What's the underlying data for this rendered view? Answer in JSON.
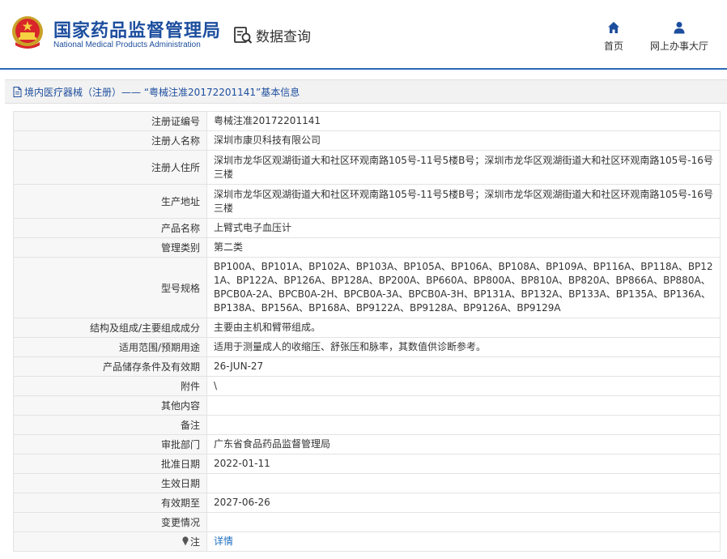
{
  "header": {
    "site_name_cn": "国家药品监督管理局",
    "site_name_en": "National Medical Products Administration",
    "query_label": "数据查询",
    "nav": [
      {
        "label": "首页",
        "icon": "home-icon"
      },
      {
        "label": "网上办事大厅",
        "icon": "user-icon"
      }
    ]
  },
  "breadcrumb": {
    "link": "境内医疗器械（注册）",
    "text": " —— “粤械注准20172201141”基本信息"
  },
  "rows": [
    {
      "key": "注册证编号",
      "value": "粤械注准20172201141"
    },
    {
      "key": "注册人名称",
      "value": "深圳市康贝科技有限公司"
    },
    {
      "key": "注册人住所",
      "value": "深圳市龙华区观湖街道大和社区环观南路105号-11号5楼B号；深圳市龙华区观湖街道大和社区环观南路105号-16号三楼"
    },
    {
      "key": "生产地址",
      "value": "深圳市龙华区观湖街道大和社区环观南路105号-11号5楼B号；深圳市龙华区观湖街道大和社区环观南路105号-16号三楼"
    },
    {
      "key": "产品名称",
      "value": "上臂式电子血压计"
    },
    {
      "key": "管理类别",
      "value": "第二类"
    },
    {
      "key": "型号规格",
      "value": "BP100A、BP101A、BP102A、BP103A、BP105A、BP106A、BP108A、BP109A、BP116A、BP118A、BP121A、BP122A、BP126A、BP128A、BP200A、BP660A、BP800A、BP810A、BP820A、BP866A、BP880A、BPCB0A-2A、BPCB0A-2H、BPCB0A-3A、BPCB0A-3H、BP131A、BP132A、BP133A、BP135A、BP136A、BP138A、BP156A、BP168A、BP9122A、BP9128A、BP9126A、BP9129A"
    },
    {
      "key": "结构及组成/主要组成成分",
      "value": "主要由主机和臂带组成。"
    },
    {
      "key": "适用范围/预期用途",
      "value": "适用于测量成人的收缩压、舒张压和脉率，其数值供诊断参考。"
    },
    {
      "key": "产品储存条件及有效期",
      "value": "26-JUN-27"
    },
    {
      "key": "附件",
      "value": "\\"
    },
    {
      "key": "其他内容",
      "value": ""
    },
    {
      "key": "备注",
      "value": ""
    },
    {
      "key": "审批部门",
      "value": "广东省食品药品监督管理局"
    },
    {
      "key": "批准日期",
      "value": "2022-01-11"
    },
    {
      "key": "生效日期",
      "value": ""
    },
    {
      "key": "有效期至",
      "value": "2027-06-26"
    },
    {
      "key": "变更情况",
      "value": ""
    },
    {
      "key": "注",
      "value": "详情",
      "icon": "pin-icon"
    }
  ],
  "colors": {
    "brand_blue": "#1d4e9e",
    "link_blue": "#1d6fc0",
    "header_line": "#2a6ab5"
  }
}
